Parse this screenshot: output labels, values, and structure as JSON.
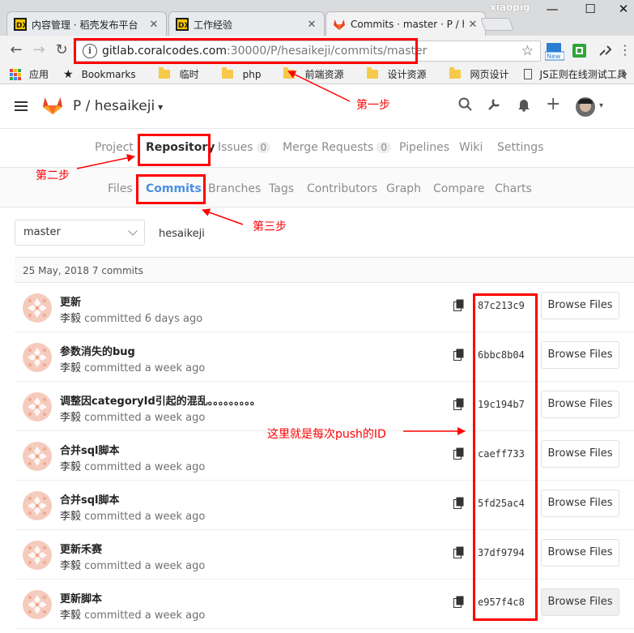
{
  "browser": {
    "tabs": [
      {
        "title": "内容管理 · 稻壳发布平台",
        "favicon": "dx-icon"
      },
      {
        "title": "工作经验",
        "favicon": "dx-icon"
      },
      {
        "title": "Commits · master · P / h",
        "favicon": "gitlab-icon"
      }
    ],
    "profile": "xiaopig",
    "url_host": "gitlab.coralcodes.com",
    "url_path": ":30000/P/hesaikeji/commits/master",
    "ext_new_label": "New",
    "bookmarks": [
      "应用",
      "Bookmarks",
      "临时",
      "php",
      "前端资源",
      "设计资源",
      "网页设计",
      "JS正则在线测试工具"
    ]
  },
  "gitlab": {
    "project_title": "P / hesaikeji",
    "nav": {
      "project": "Project",
      "repository": "Repository",
      "issues": "Issues",
      "issues_count": "0",
      "merge_requests": "Merge Requests",
      "mr_count": "0",
      "pipelines": "Pipelines",
      "wiki": "Wiki",
      "settings": "Settings"
    },
    "subnav": {
      "files": "Files",
      "commits": "Commits",
      "branches": "Branches",
      "tags": "Tags",
      "contributors": "Contributors",
      "graph": "Graph",
      "compare": "Compare",
      "charts": "Charts"
    },
    "branch": "master",
    "path": "hesaikeji",
    "day_header": "25 May, 2018 7 commits",
    "browse_label": "Browse Files",
    "commits": [
      {
        "title": "更新",
        "author": "李毅",
        "verb": "committed",
        "time": "6 days ago",
        "sha": "87c213c9"
      },
      {
        "title": "参数消失的bug",
        "author": "李毅",
        "verb": "committed",
        "time": "a week ago",
        "sha": "6bbc8b04"
      },
      {
        "title": "调整因categoryId引起的混乱。。。。。。。。。",
        "author": "李毅",
        "verb": "committed",
        "time": "a week ago",
        "sha": "19c194b7"
      },
      {
        "title": "合并sql脚本",
        "author": "李毅",
        "verb": "committed",
        "time": "a week ago",
        "sha": "caeff733"
      },
      {
        "title": "合并sql脚本",
        "author": "李毅",
        "verb": "committed",
        "time": "a week ago",
        "sha": "5fd25ac4"
      },
      {
        "title": "更新禾赛",
        "author": "李毅",
        "verb": "committed",
        "time": "a week ago",
        "sha": "37df9794"
      },
      {
        "title": "更新脚本",
        "author": "李毅",
        "verb": "committed",
        "time": "a week ago",
        "sha": "e957f4c8"
      }
    ]
  },
  "annotations": {
    "step1": "第一步",
    "step2": "第二步",
    "step3": "第三步",
    "push_id": "这里就是每次push的ID"
  },
  "colors": {
    "annotation": "#ff0000",
    "active_subnav": "#4a90e2",
    "gitlab_orange": "#e24329"
  }
}
